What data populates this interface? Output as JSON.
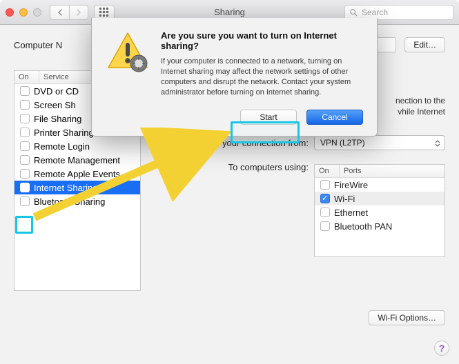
{
  "titlebar": {
    "title": "Sharing",
    "search_placeholder": "Search"
  },
  "top": {
    "computer_name_label": "Computer N",
    "edit_button": "Edit…"
  },
  "services": {
    "header_on": "On",
    "header_service": "Service",
    "items": [
      {
        "label": "DVD or CD"
      },
      {
        "label": "Screen Sh"
      },
      {
        "label": "File Sharing"
      },
      {
        "label": "Printer Sharing"
      },
      {
        "label": "Remote Login"
      },
      {
        "label": "Remote Management"
      },
      {
        "label": "Remote Apple Events"
      },
      {
        "label": "Internet Sharing"
      },
      {
        "label": "Bluetooth Sharing"
      }
    ]
  },
  "right": {
    "desc_line1": "nection to the",
    "desc_line2": "vhile Internet",
    "share_from_label": "Share your connection from:",
    "share_from_value": "VPN (L2TP)",
    "to_label": "To computers using:",
    "ports_header_on": "On",
    "ports_header_ports": "Ports",
    "ports": [
      {
        "label": "FireWire",
        "checked": false
      },
      {
        "label": "Wi-Fi",
        "checked": true
      },
      {
        "label": "Ethernet",
        "checked": false
      },
      {
        "label": "Bluetooth PAN",
        "checked": false
      }
    ],
    "wifi_options": "Wi-Fi Options…"
  },
  "dialog": {
    "title": "Are you sure you want to turn on Internet sharing?",
    "message": "If your computer is connected to a network, turning on Internet sharing may affect the network settings of other computers and disrupt the network. Contact your system administrator before turning on Internet sharing.",
    "start": "Start",
    "cancel": "Cancel"
  },
  "help": "?"
}
